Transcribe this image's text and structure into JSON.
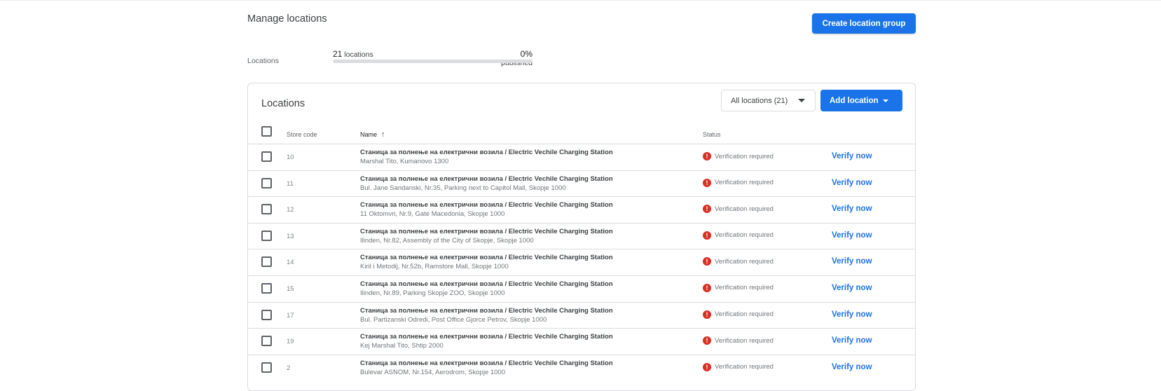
{
  "page": {
    "title": "Manage locations",
    "create_group_label": "Create location group"
  },
  "summary": {
    "label": "Locations",
    "count_value": "21",
    "count_suffix": " locations",
    "published_value": "0%",
    "published_suffix": " published",
    "published_fraction": 0
  },
  "card": {
    "title": "Locations",
    "filter_label": "All locations (21)",
    "add_location_label": "Add location",
    "columns": {
      "store_code": "Store code",
      "name": "Name",
      "name_sort": "↑",
      "status": "Status"
    },
    "rows": [
      {
        "code": "10",
        "name": "Станица за полнење на електрични возила / Electric Vechile Charging Station",
        "address": "Marshal Tito, Kumanovo 1300",
        "status": "Verification required",
        "action": "Verify now"
      },
      {
        "code": "11",
        "name": "Станица за полнење на електрични возила / Electric Vechile Charging Station",
        "address": "Bul. Jane Sandanski, Nr.35, Parking next to Capitol Mall, Skopje 1000",
        "status": "Verification required",
        "action": "Verify now"
      },
      {
        "code": "12",
        "name": "Станица за полнење на електрични возила / Electric Vechile Charging Station",
        "address": "11 Oktomvri, Nr.9, Gate Macedonia, Skopje 1000",
        "status": "Verification required",
        "action": "Verify now"
      },
      {
        "code": "13",
        "name": "Станица за полнење на електрични возила / Electric Vechile Charging Station",
        "address": "Ilinden, Nr.82, Assembly of the City of Skopje, Skopje 1000",
        "status": "Verification required",
        "action": "Verify now"
      },
      {
        "code": "14",
        "name": "Станица за полнење на електрични возила / Electric Vechile Charging Station",
        "address": "Kiril i Metodij, Nr.52b, Ramstore Mall, Skopje 1000",
        "status": "Verification required",
        "action": "Verify now"
      },
      {
        "code": "15",
        "name": "Станица за полнење на електрични возила / Electric Vechile Charging Station",
        "address": "Ilinden, Nr.89, Parking Skopje ZOO, Skopje 1000",
        "status": "Verification required",
        "action": "Verify now"
      },
      {
        "code": "17",
        "name": "Станица за полнење на електрични возила / Electric Vechile Charging Station",
        "address": "Bul. Partizanski Odredi, Post Office Gjorce Petrov, Skopje 1000",
        "status": "Verification required",
        "action": "Verify now"
      },
      {
        "code": "19",
        "name": "Станица за полнење на електрични возила / Electric Vechile Charging Station",
        "address": "Kej Marshal Tito, Shtip 2000",
        "status": "Verification required",
        "action": "Verify now"
      },
      {
        "code": "2",
        "name": "Станица за полнење на електрични возила / Electric Vechile Charging Station",
        "address": "Bulevar ASNOM, Nr.154, Aerodrom, Skopje 1000",
        "status": "Verification required",
        "action": "Verify now"
      }
    ]
  },
  "icons": {
    "alert": "!",
    "status_alert_name": "error-alert-icon"
  },
  "colors": {
    "primary": "#1a73e8",
    "error": "#d93025"
  }
}
